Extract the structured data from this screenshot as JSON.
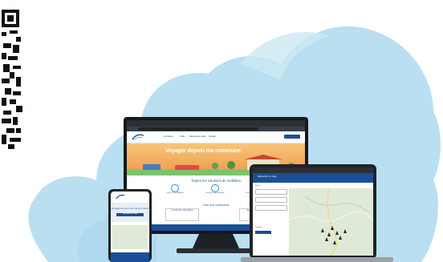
{
  "monitor": {
    "nav_items": [
      "Je réserve",
      "Trafic",
      "Ressources utiles",
      "Contact"
    ],
    "hero_title": "Voyager depuis ma commune",
    "section_title": "Toutes les solutions de mobilités",
    "cards": [
      "Lignes ET et Mobilités",
      "Transport à la demande",
      "Transport flexi desservie"
    ],
    "list_title": "Liste des communes",
    "commune_buttons": [
      "Accéder aux informations",
      "Rechercher"
    ]
  },
  "tablet": {
    "header_button": "Rechercher un trajet",
    "filter_label": "Filtres",
    "legend": "Légende"
  },
  "phone": {
    "hero_title": "Voyager de mon nom de commune",
    "button": "Rechercher un trajet"
  },
  "colors": {
    "cloud": "#b9dff0",
    "cloud_dark": "#8cc8e6",
    "brand_blue": "#1a4f97",
    "hero_orange": "#ef9a48"
  }
}
